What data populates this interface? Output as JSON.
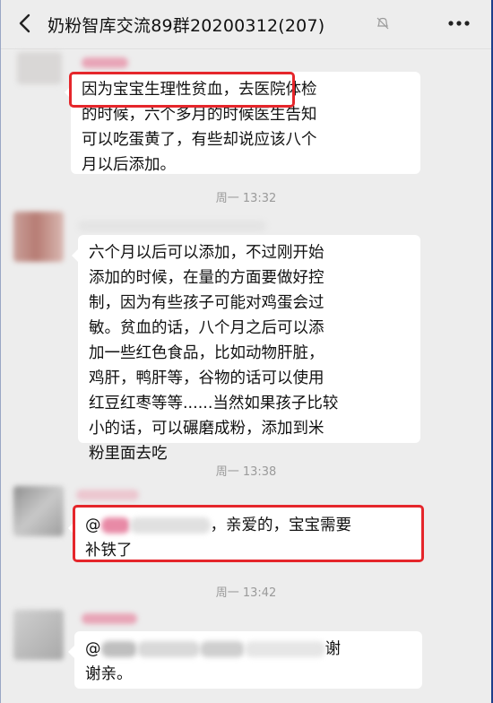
{
  "header": {
    "title": "奶粉智库交流89群20200312(207)",
    "back_icon": "chevron-left-icon",
    "mute_icon": "bell-off-icon",
    "more_icon": "more-dots-icon"
  },
  "messages": [
    {
      "line1_highlight": "因为宝宝生理性贫血，",
      "line1_rest": "去医院体检",
      "line2": "的时候，六个多月的时候医生告知",
      "line3": "可以吃蛋黄了，有些却说应该八个",
      "line4": "月以后添加。"
    },
    {
      "lines": [
        "六个月以后可以添加，不过刚开始",
        "添加的时候，在量的方面要做好控",
        "制，因为有些孩子可能对鸡蛋会过",
        "敏。贫血的话，八个月之后可以添",
        "加一些红色食品，比如动物肝脏，",
        "鸡肝，鸭肝等，谷物的话可以使用",
        "红豆红枣等等......当然如果孩子比较",
        "小的话，可以碾磨成粉，添加到米",
        "粉里面去吃"
      ]
    },
    {
      "prefix": "@",
      "line1": "，亲爱的，宝宝需要",
      "line2": "补铁了"
    },
    {
      "prefix": "@",
      "line1_end": "谢",
      "line2": "谢亲。"
    }
  ],
  "timestamps": [
    "周一 13:32",
    "周一 13:38",
    "周一 13:42"
  ]
}
